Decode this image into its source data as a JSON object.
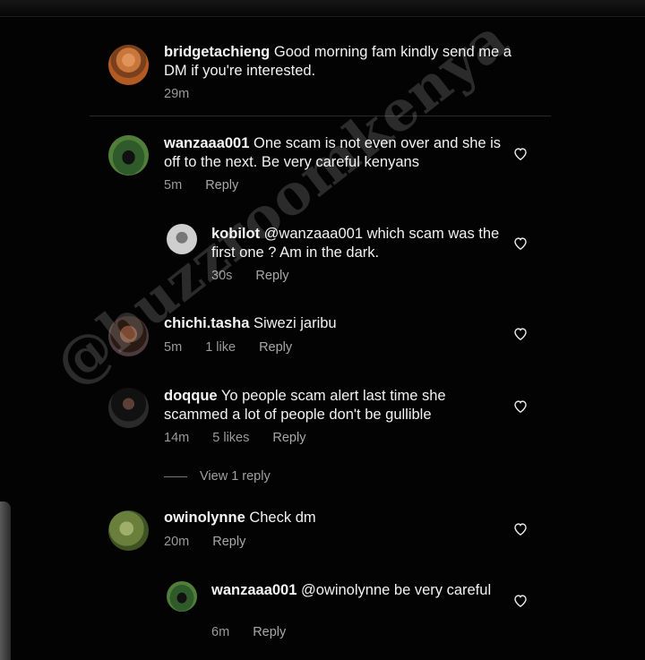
{
  "watermark": "@buzzroomkenya",
  "comments": [
    {
      "username": "bridgetachieng",
      "text": "Good morning fam kindly send me a DM if you're interested.",
      "time": "29m",
      "likes": "",
      "reply_label": ""
    },
    {
      "username": "wanzaaa001",
      "text": "One scam is not even over and she is off to the next. Be very careful kenyans",
      "time": "5m",
      "likes": "",
      "reply_label": "Reply"
    },
    {
      "username": "kobilot",
      "text": "@wanzaaa001 which scam was the first one ? Am in the dark.",
      "time": "30s",
      "likes": "",
      "reply_label": "Reply"
    },
    {
      "username": "chichi.tasha",
      "text": "Siwezi jaribu",
      "time": "5m",
      "likes": "1 like",
      "reply_label": "Reply"
    },
    {
      "username": "doqque",
      "text": "Yo people scam alert last time she scammed a lot of people don't be gullible",
      "time": "14m",
      "likes": "5 likes",
      "reply_label": "Reply"
    },
    {
      "username": "owinolynne",
      "text": "Check dm",
      "time": "20m",
      "likes": "",
      "reply_label": "Reply"
    },
    {
      "username": "wanzaaa001",
      "text": "@owinolynne be very careful",
      "time": "6m",
      "likes": "",
      "reply_label": "Reply"
    }
  ],
  "view_replies": "View 1 reply",
  "icons": {
    "like": "heart-outline-icon"
  },
  "colors": {
    "background": "#030303",
    "text": "#f2f2f2",
    "meta": "#9a9a9a"
  }
}
